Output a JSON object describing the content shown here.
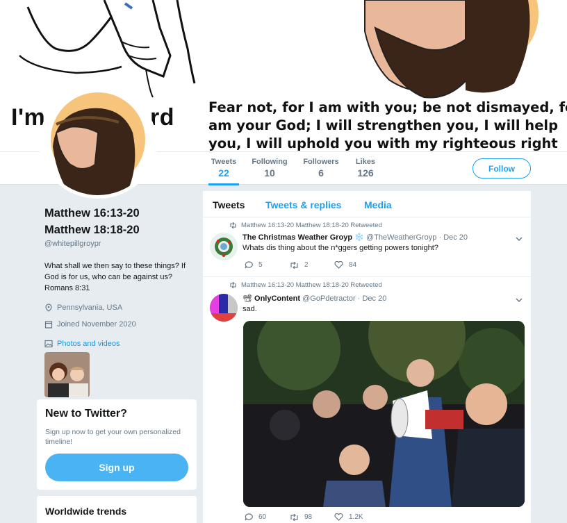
{
  "banner": {
    "left_caption_start": "I'm",
    "left_caption_end": "rd",
    "quote_lines": [
      "Fear not, for I am with you; be not dismayed, for",
      "am your God; I will strengthen you, I will help",
      "you, I will uphold you with my righteous right"
    ]
  },
  "stats": [
    {
      "label": "Tweets",
      "value": "22"
    },
    {
      "label": "Following",
      "value": "10"
    },
    {
      "label": "Followers",
      "value": "6"
    },
    {
      "label": "Likes",
      "value": "126"
    }
  ],
  "follow_label": "Follow",
  "profile": {
    "name_line1": "Matthew 16:13-20",
    "name_line2": "Matthew 18:18-20",
    "handle": "@whitepillgroypr",
    "bio": "What shall we then say to these things? If God is for us, who can be against us? Romans 8:31",
    "location": "Pennsylvania, USA",
    "joined": "Joined November 2020",
    "photos_label": "Photos and videos"
  },
  "signup": {
    "title": "New to Twitter?",
    "text": "Sign up now to get your own personalized timeline!",
    "button": "Sign up"
  },
  "trends_title": "Worldwide trends",
  "tabs": [
    "Tweets",
    "Tweets & replies",
    "Media"
  ],
  "tweets": [
    {
      "retweet_label": "Matthew 16:13-20 Matthew 18:18-20 Retweeted",
      "name": "The Christmas Weather Groyp",
      "snowflake": "❄️",
      "handle": "@TheWeatherGroyp",
      "date": "· Dec 20",
      "text": "Whats dis thing about the n*ggers getting powers tonight?",
      "replies": "5",
      "retweets": "2",
      "likes": "84"
    },
    {
      "retweet_label": "Matthew 16:13-20 Matthew 18:18-20 Retweeted",
      "name_prefix": "📽",
      "name": "OnlyContent",
      "handle": "@GoPdetractor",
      "date": "· Dec 20",
      "text": "sad.",
      "replies": "60",
      "retweets": "98",
      "likes": "1.2K"
    }
  ],
  "colors": {
    "accent": "#1da1f2",
    "background": "#e6ecf0",
    "muted": "#657786"
  }
}
